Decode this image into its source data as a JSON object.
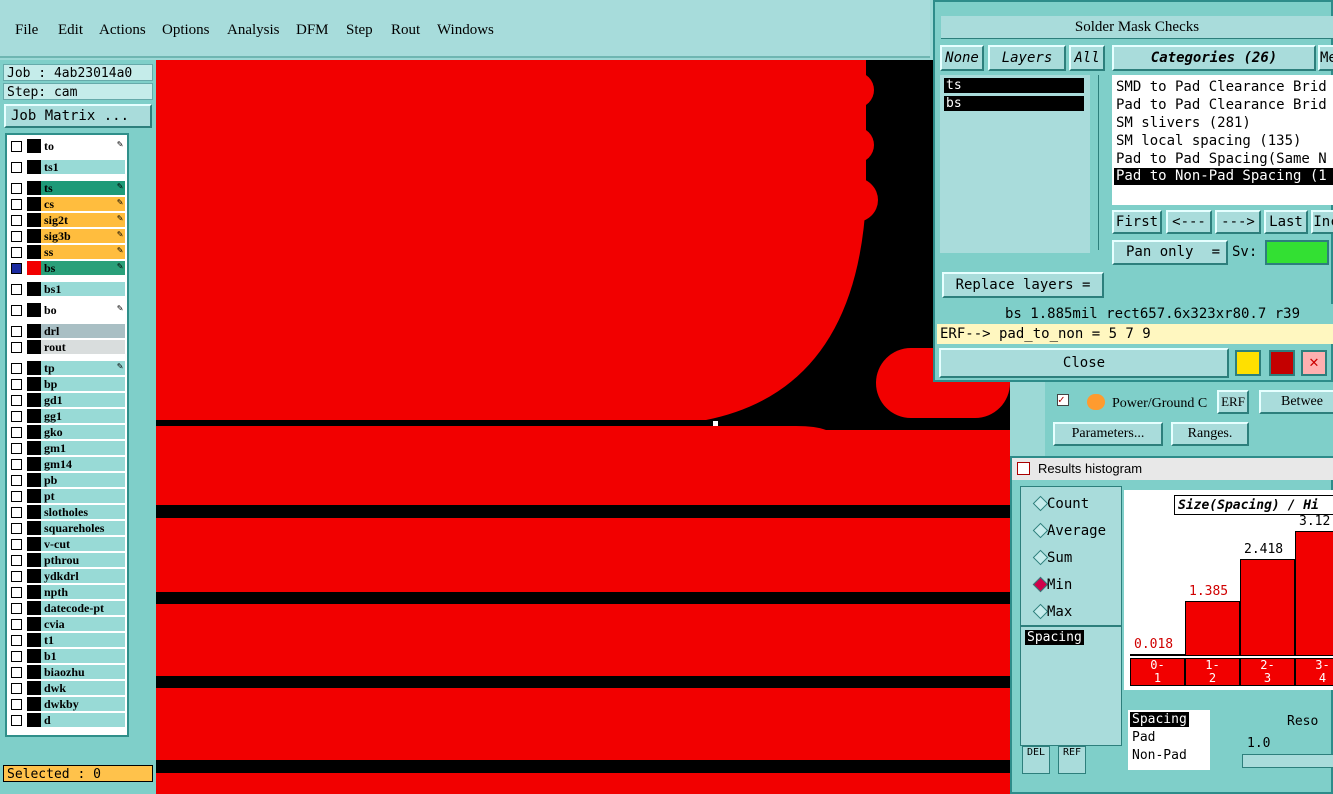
{
  "menu": [
    "File",
    "Edit",
    "Actions",
    "Options",
    "Analysis",
    "DFM",
    "Step",
    "Rout",
    "Windows"
  ],
  "left": {
    "job": "Job : 4ab23014a0",
    "step": "Step: cam",
    "job_matrix": "Job Matrix ...",
    "selected": "Selected : 0",
    "layers": [
      {
        "name": "to",
        "style": "white",
        "edit": true
      },
      {
        "name": "ts1",
        "style": "cyan",
        "edit": false
      },
      {
        "name": "ts",
        "style": "teal",
        "edit": true
      },
      {
        "name": "cs",
        "style": "orange",
        "edit": true
      },
      {
        "name": "sig2t",
        "style": "orange",
        "edit": true
      },
      {
        "name": "sig3b",
        "style": "orange",
        "edit": true
      },
      {
        "name": "ss",
        "style": "orange",
        "edit": true
      },
      {
        "name": "bs",
        "style": "green",
        "edit": true
      },
      {
        "name": "bs1",
        "style": "cyan",
        "edit": false
      },
      {
        "name": "bo",
        "style": "white",
        "edit": true
      },
      {
        "name": "drl",
        "style": "gray",
        "edit": false
      },
      {
        "name": "rout",
        "style": "lgray",
        "edit": false
      },
      {
        "name": "tp",
        "style": "cyan",
        "edit": true
      },
      {
        "name": "bp",
        "style": "cyan",
        "edit": false
      },
      {
        "name": "gd1",
        "style": "cyan",
        "edit": false
      },
      {
        "name": "gg1",
        "style": "cyan",
        "edit": false
      },
      {
        "name": "gko",
        "style": "cyan",
        "edit": false
      },
      {
        "name": "gm1",
        "style": "cyan",
        "edit": false
      },
      {
        "name": "gm14",
        "style": "cyan",
        "edit": false
      },
      {
        "name": "pb",
        "style": "cyan",
        "edit": false
      },
      {
        "name": "pt",
        "style": "cyan",
        "edit": false
      },
      {
        "name": "slotholes",
        "style": "cyan",
        "edit": false
      },
      {
        "name": "squareholes",
        "style": "cyan",
        "edit": false
      },
      {
        "name": "v-cut",
        "style": "cyan",
        "edit": false
      },
      {
        "name": "pthrou",
        "style": "cyan",
        "edit": false
      },
      {
        "name": "ydkdrl",
        "style": "cyan",
        "edit": false
      },
      {
        "name": "npth",
        "style": "cyan",
        "edit": false
      },
      {
        "name": "datecode-pt",
        "style": "cyan",
        "edit": false
      },
      {
        "name": "cvia",
        "style": "cyan",
        "edit": false
      },
      {
        "name": "t1",
        "style": "cyan",
        "edit": false
      },
      {
        "name": "b1",
        "style": "cyan",
        "edit": false
      },
      {
        "name": "biaozhu",
        "style": "cyan",
        "edit": false
      },
      {
        "name": "dwk",
        "style": "cyan",
        "edit": false
      },
      {
        "name": "dwkby",
        "style": "cyan",
        "edit": false
      },
      {
        "name": "d",
        "style": "cyan",
        "edit": false
      }
    ]
  },
  "results_viewer": {
    "title": "Solder Mask Checks",
    "none_btn": "None",
    "layers_btn": "Layers",
    "all_btn": "All",
    "categories_btn": "Categories (26)",
    "me_btn": "Me",
    "layer_items": [
      "ts",
      "bs"
    ],
    "categories": [
      "SMD to Pad Clearance Brid",
      "Pad to Pad Clearance Brid",
      "SM slivers (281)",
      "SM local spacing (135)",
      "Pad to Pad Spacing(Same N",
      "Pad to Non-Pad Spacing (1"
    ],
    "first": "First",
    "prev": "<---",
    "next": "--->",
    "last": "Last",
    "inc": "Inc",
    "pan_only": "Pan only",
    "sv": "Sv:",
    "replace_layers": "Replace layers",
    "status_line": "bs 1.885mil  rect657.6x323xr80.7  r39",
    "erf_line": "ERF--> pad_to_non = 5 7 9",
    "close": "Close"
  },
  "behind": {
    "power_ground": "Power/Ground C",
    "erf": "ERF",
    "between": "Betwee",
    "parameters": "Parameters...",
    "ranges": "Ranges."
  },
  "histogram": {
    "title": "Results histogram",
    "options": [
      "Count",
      "Average",
      "Sum",
      "Min",
      "Max"
    ],
    "selected_option": "Min",
    "field": "Spacing",
    "del": "DEL",
    "ref": "REF",
    "header": "Size(Spacing) / Hi",
    "filter_items": [
      "Spacing",
      "Pad",
      "Non-Pad"
    ],
    "reso": "Reso",
    "reso_value": "1.0",
    "chart_data": {
      "type": "bar",
      "categories": [
        "0-1",
        "1-2",
        "2-3",
        "3-4"
      ],
      "values": [
        0.018,
        1.385,
        2.418,
        3.12
      ],
      "value_labels": [
        "0.018",
        "1.385",
        "2.418",
        "3.12"
      ],
      "cat_labels": [
        [
          "0-",
          "1"
        ],
        [
          "1-",
          "2"
        ],
        [
          "2-",
          "3"
        ],
        [
          "3-",
          "4"
        ]
      ],
      "ylim": [
        0,
        3.5
      ]
    }
  }
}
